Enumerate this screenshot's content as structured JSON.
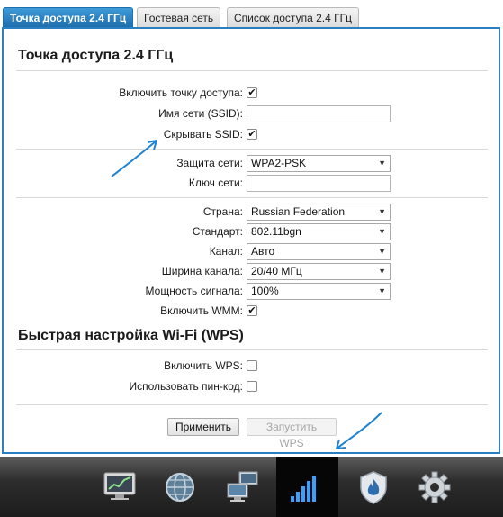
{
  "tabs": [
    {
      "label": "Точка доступа 2.4 ГГц",
      "active": true
    },
    {
      "label": "Гостевая сеть",
      "active": false
    },
    {
      "label": "Список доступа 2.4 ГГц",
      "active": false
    }
  ],
  "ap_section": {
    "title": "Точка доступа 2.4 ГГц",
    "enable_ap": {
      "label": "Включить точку доступа:",
      "checked": true
    },
    "ssid": {
      "label": "Имя сети (SSID):",
      "value": ""
    },
    "hide_ssid": {
      "label": "Скрывать SSID:",
      "checked": true
    },
    "security": {
      "label": "Защита сети:",
      "value": "WPA2-PSK"
    },
    "key": {
      "label": "Ключ сети:",
      "value": ""
    },
    "country": {
      "label": "Страна:",
      "value": "Russian Federation"
    },
    "standard": {
      "label": "Стандарт:",
      "value": "802.11bgn"
    },
    "channel": {
      "label": "Канал:",
      "value": "Авто"
    },
    "bandwidth": {
      "label": "Ширина канала:",
      "value": "20/40 МГц"
    },
    "power": {
      "label": "Мощность сигнала:",
      "value": "100%"
    },
    "wmm": {
      "label": "Включить WMM:",
      "checked": true
    }
  },
  "wps_section": {
    "title": "Быстрая настройка Wi-Fi (WPS)",
    "enable_wps": {
      "label": "Включить WPS:",
      "checked": false
    },
    "use_pin": {
      "label": "Использовать пин-код:",
      "checked": false
    }
  },
  "buttons": {
    "apply": "Применить",
    "run_wps": "Запустить WPS"
  },
  "check_mark": "✔",
  "dropdown_arrow": "▼",
  "bottom_nav": [
    {
      "icon": "monitor-chart-icon",
      "active": false
    },
    {
      "icon": "globe-icon",
      "active": false
    },
    {
      "icon": "network-computers-icon",
      "active": false
    },
    {
      "icon": "wifi-signal-icon",
      "active": true
    },
    {
      "icon": "shield-flame-icon",
      "active": false
    },
    {
      "icon": "gear-icon",
      "active": false
    }
  ],
  "colors": {
    "accent": "#2a7fc0",
    "tab_active": "#1e6fae",
    "bottom_bar": "#2d2d2d",
    "annotation_arrow": "#1e84d0"
  }
}
